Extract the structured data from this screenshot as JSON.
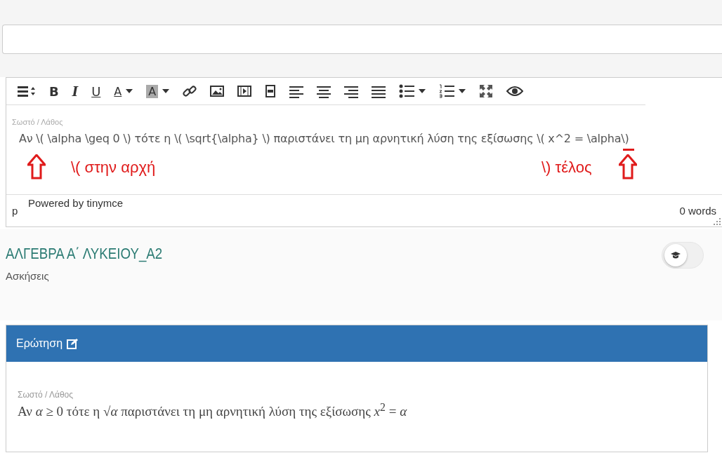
{
  "editor": {
    "toolbar": [
      {
        "kind": "formats",
        "dropdown": false
      },
      {
        "kind": "bold",
        "label": "B",
        "dropdown": false
      },
      {
        "kind": "italic",
        "label": "I",
        "dropdown": false
      },
      {
        "kind": "underline",
        "label": "U",
        "dropdown": false
      },
      {
        "kind": "text-color",
        "label": "A",
        "dropdown": true
      },
      {
        "kind": "bg-color",
        "label": "A",
        "dropdown": true
      },
      {
        "kind": "link",
        "dropdown": false
      },
      {
        "kind": "image",
        "dropdown": false
      },
      {
        "kind": "media",
        "dropdown": false
      },
      {
        "kind": "film",
        "dropdown": false
      },
      {
        "kind": "align-left",
        "dropdown": false
      },
      {
        "kind": "align-center",
        "dropdown": false
      },
      {
        "kind": "align-right",
        "dropdown": false
      },
      {
        "kind": "justify",
        "dropdown": false
      },
      {
        "kind": "bullets",
        "dropdown": true
      },
      {
        "kind": "numbers",
        "dropdown": true
      },
      {
        "kind": "fullscreen",
        "dropdown": false
      },
      {
        "kind": "preview",
        "dropdown": false
      }
    ],
    "label": "Σωστό / Λάθος",
    "content": "Αν \\( \\alpha \\geq 0 \\) τότε η \\( \\sqrt{\\alpha} \\) παριστάνει τη μη αρνητική λύση της εξίσωσης \\( x^2 = \\alpha\\)",
    "annotations": [
      {
        "text": "\\(  στην αρχή"
      },
      {
        "text": "\\) τέλος"
      }
    ],
    "path": "p",
    "branding": "Powered by tinymce",
    "word_count": "0 words"
  },
  "course": {
    "title": "ΑΛΓΕΒΡΑ Α΄ ΛΥΚΕΙΟΥ_Α2",
    "subtitle": "Ασκήσεις",
    "toggle_on": false
  },
  "question": {
    "header": "Ερώτηση",
    "label": "Σωστό / Λάθος",
    "text": "Αν *α* ≥ 0 τότε η √*α* παριστάνει τη μη αρνητική λύση της εξίσωσης *x*$^{2}$ = *α*"
  }
}
